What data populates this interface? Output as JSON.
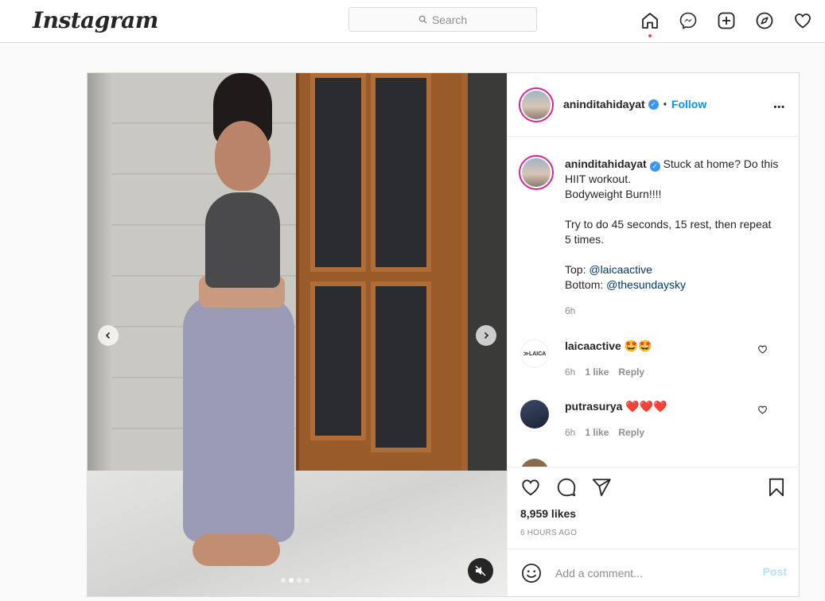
{
  "nav": {
    "logo": "Instagram",
    "search_placeholder": "Search",
    "icons": [
      "home-icon",
      "messenger-icon",
      "new-post-icon",
      "explore-icon",
      "activity-heart-icon"
    ]
  },
  "post": {
    "author": "aninditahidayat",
    "verified": true,
    "separator": "•",
    "follow_label": "Follow",
    "more_label": "•••",
    "caption": {
      "username": "aninditahidayat",
      "text_1": "Stuck at home? Do this HIIT workout.\nBodyweight Burn!!!!\n\nTry to do 45 seconds, 15 rest, then repeat 5 times.\n\nTop: ",
      "mention_top": "@laicaactive",
      "text_2": "\nBottom: ",
      "mention_bottom": "@thesundaysky",
      "time": "6h"
    },
    "comments": [
      {
        "username": "laicaactive",
        "avatar_text": "≫LAICA",
        "text": "🤩🤩",
        "time": "6h",
        "likes": "1 like",
        "reply": "Reply"
      },
      {
        "username": "putrasurya",
        "text": "❤️❤️❤️",
        "time": "6h",
        "likes": "1 like",
        "reply": "Reply"
      }
    ],
    "likes": "8,959 likes",
    "time_ago": "6 HOURS AGO",
    "add_comment_placeholder": "Add a comment...",
    "post_button": "Post",
    "carousel": {
      "total": 4,
      "active": 1
    }
  },
  "colors": {
    "accent": "#0095f6",
    "border": "#dbdbdb",
    "verified": "#3897f0",
    "notification": "#ed4956"
  }
}
